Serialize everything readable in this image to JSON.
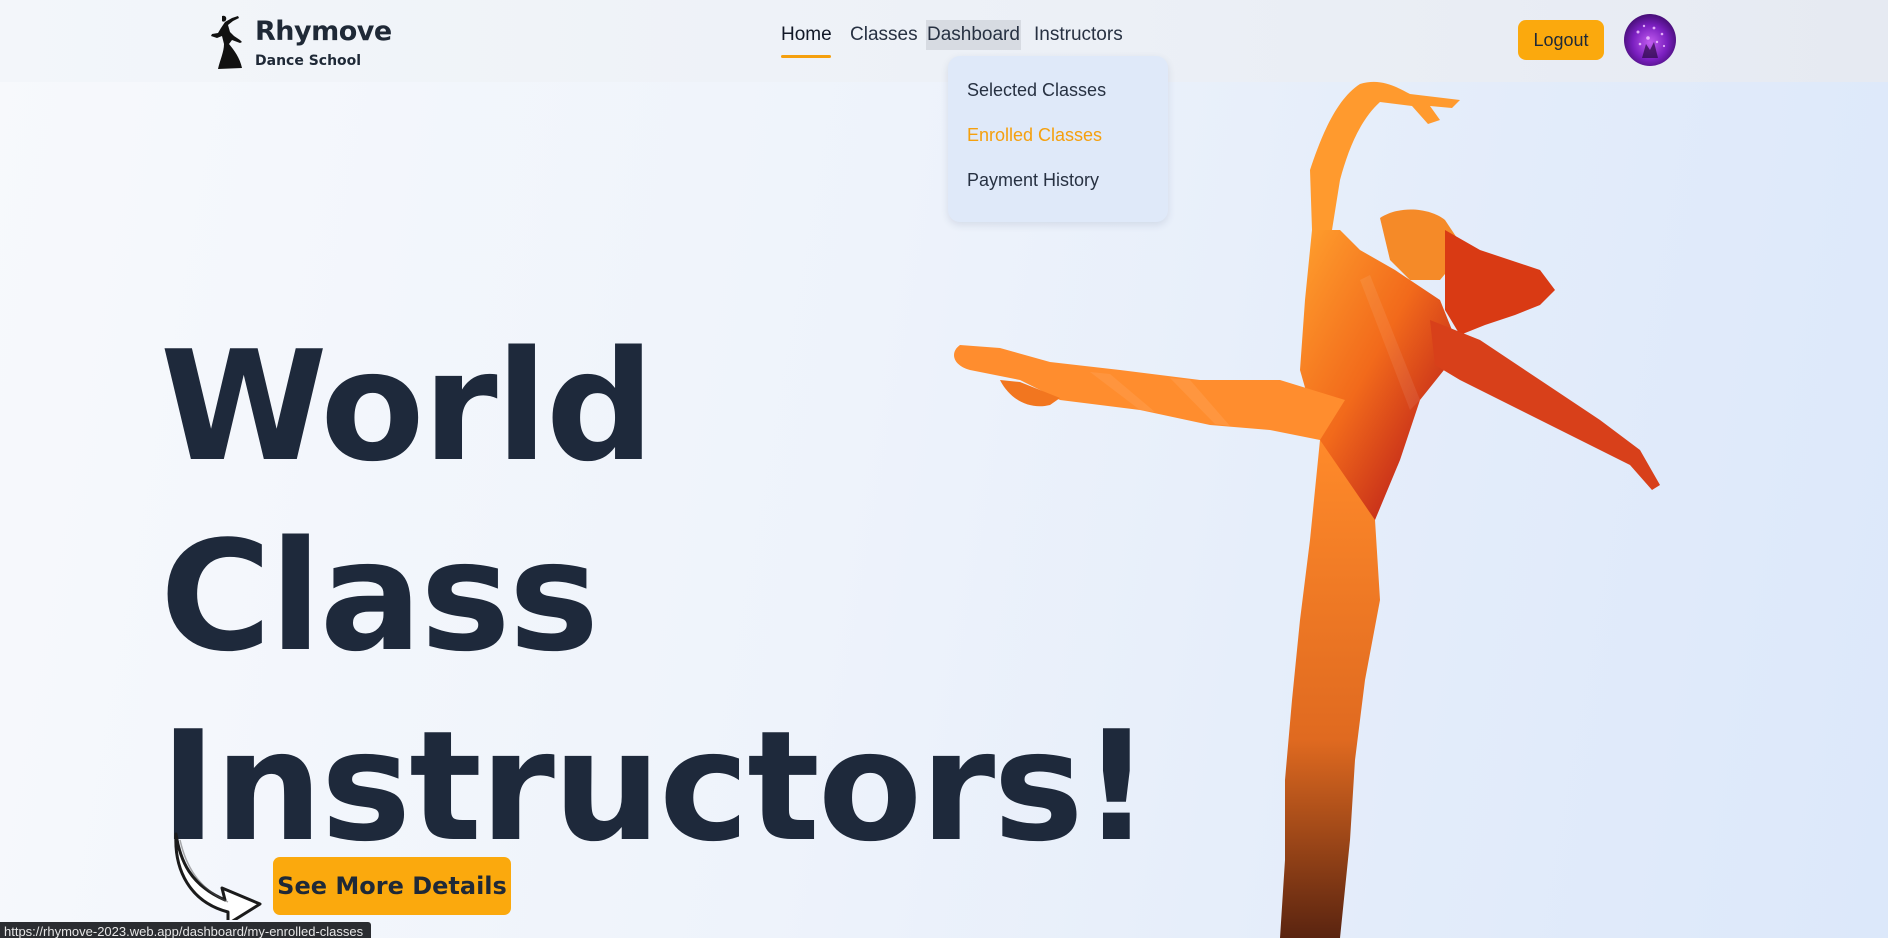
{
  "brand": {
    "title": "Rhymove",
    "subtitle": "Dance School"
  },
  "nav": {
    "items": [
      {
        "label": "Home",
        "active": true
      },
      {
        "label": "Classes"
      },
      {
        "label": "Dashboard",
        "hovered": true
      },
      {
        "label": "Instructors"
      }
    ],
    "dropdown": [
      {
        "label": "Selected Classes"
      },
      {
        "label": "Enrolled Classes",
        "highlighted": true
      },
      {
        "label": "Payment History"
      }
    ],
    "logout_label": "Logout"
  },
  "hero": {
    "lines": [
      "World",
      "Class",
      "Instructors!"
    ],
    "cta_label": "See More Details"
  },
  "status_bar": {
    "url": "https://rhymove-2023.web.app/dashboard/my-enrolled-classes"
  },
  "colors": {
    "accent": "#fba90d",
    "text": "#1e293b",
    "dropdown_bg": "#dfe9f9"
  },
  "icons": {
    "logo": "dancer-silhouette-icon",
    "avatar": "user-avatar",
    "cta_arrow": "curved-arrow-icon"
  }
}
